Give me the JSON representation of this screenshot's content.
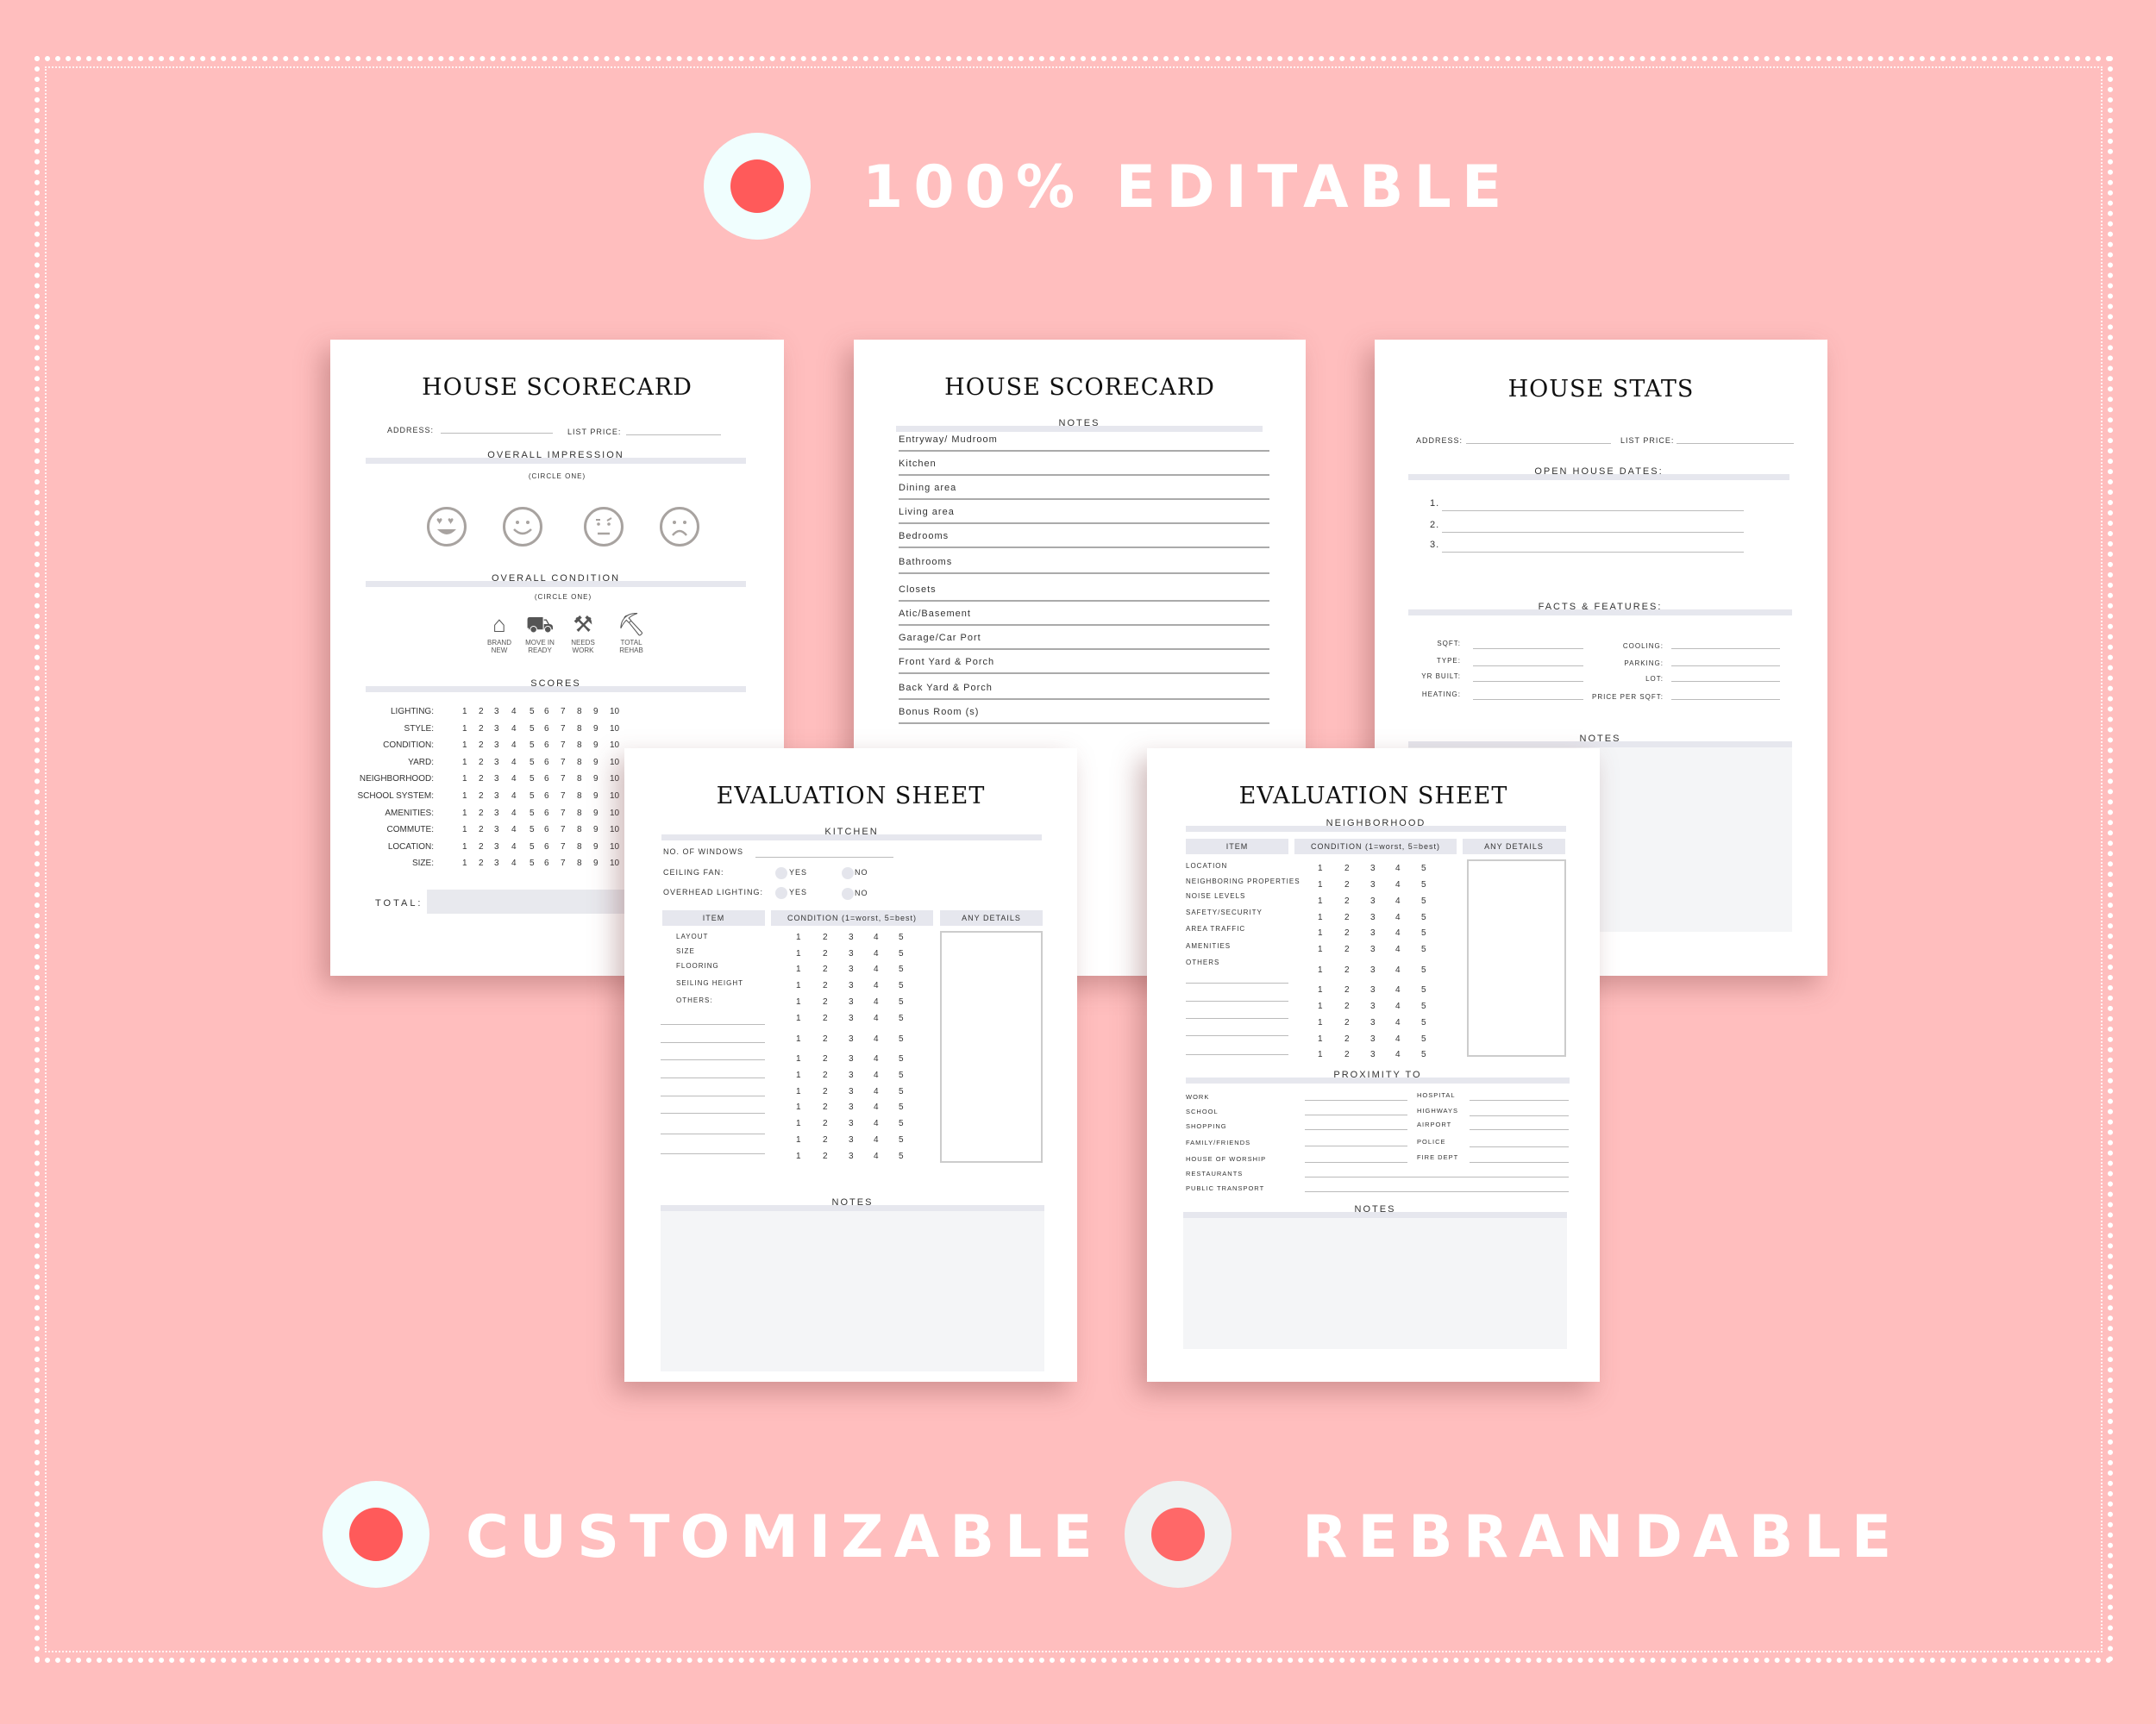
{
  "banner": {
    "top_label": "100% EDITABLE",
    "bottom_left_label": "CUSTOMIZABLE",
    "bottom_right_label": "REBRANDABLE",
    "colors": {
      "background": "#FFBEBE",
      "badge_outer": "#F0FEFE",
      "badge_inner": "#FF5A5A",
      "text": "#FFFFFF"
    }
  },
  "scorecard": {
    "title": "HOUSE SCORECARD",
    "address_label": "ADDRESS:",
    "list_price_label": "LIST PRICE:",
    "impression_header": "OVERALL IMPRESSION",
    "impression_sub": "(CIRCLE ONE)",
    "faces": [
      "heart-eyes-face-icon",
      "smile-face-icon",
      "unamused-face-icon",
      "frown-face-icon"
    ],
    "condition_header": "OVERALL CONDITION",
    "condition_sub": "(CIRCLE ONE)",
    "conditions": [
      {
        "icon": "house-icon",
        "glyph": "⌂",
        "line1": "BRAND",
        "line2": "NEW"
      },
      {
        "icon": "truck-icon",
        "glyph": "⛟",
        "line1": "MOVE IN",
        "line2": "READY"
      },
      {
        "icon": "spray-paint-icon",
        "glyph": "⚒",
        "line1": "NEEDS",
        "line2": "WORK"
      },
      {
        "icon": "wheelbarrow-icon",
        "glyph": "⛏",
        "line1": "TOTAL",
        "line2": "REHAB"
      }
    ],
    "scores_header": "SCORES",
    "score_items": [
      "LIGHTING:",
      "STYLE:",
      "CONDITION:",
      "YARD:",
      "NEIGHBORHOOD:",
      "SCHOOL SYSTEM:",
      "AMENITIES:",
      "COMMUTE:",
      "LOCATION:",
      "SIZE:"
    ],
    "score_scale": [
      "1",
      "2",
      "3",
      "4",
      "5",
      "6",
      "7",
      "8",
      "9",
      "10"
    ],
    "total_label": "TOTAL:"
  },
  "scorecard_notes": {
    "title": "HOUSE SCORECARD",
    "notes_header": "NOTES",
    "rooms": [
      "Entryway/ Mudroom",
      "Kitchen",
      "Dining area",
      "Living area",
      "Bedrooms",
      "Bathrooms",
      "Closets",
      "Atic/Basement",
      "Garage/Car Port",
      "Front Yard & Porch",
      "Back Yard & Porch",
      "Bonus Room (s)"
    ]
  },
  "stats": {
    "title": "HOUSE STATS",
    "address_label": "ADDRESS:",
    "list_price_label": "LIST PRICE:",
    "open_house_header": "OPEN HOUSE DATES:",
    "open_house_items": [
      "1.",
      "2.",
      "3."
    ],
    "facts_header": "FACTS & FEATURES:",
    "facts_left": [
      "SQFT:",
      "TYPE:",
      "YR BUILT:",
      "HEATING:"
    ],
    "facts_right": [
      "COOLING:",
      "PARKING:",
      "LOT:",
      "PRICE PER SQFT:"
    ],
    "notes_header": "NOTES"
  },
  "eval_kitchen": {
    "title": "EVALUATION SHEET",
    "section": "KITCHEN",
    "windows_label": "NO. OF WINDOWS",
    "ceiling_fan_label": "CEILING FAN:",
    "overhead_label": "OVERHEAD LIGHTING:",
    "yes": "YES",
    "no": "NO",
    "col_item": "ITEM",
    "col_condition": "CONDITION (1=worst, 5=best)",
    "col_details": "ANY DETAILS",
    "items": [
      "LAYOUT",
      "SIZE",
      "FLOORING",
      "SEILING HEIGHT",
      "OTHERS:"
    ],
    "scale": [
      "1",
      "2",
      "3",
      "4",
      "5"
    ],
    "notes_header": "NOTES"
  },
  "eval_neighborhood": {
    "title": "EVALUATION SHEET",
    "section": "NEIGHBORHOOD",
    "col_item": "ITEM",
    "col_condition": "CONDITION (1=worst, 5=best)",
    "col_details": "ANY DETAILS",
    "items": [
      "LOCATION",
      "NEIGHBORING PROPERTIES",
      "NOISE LEVELS",
      "SAFETY/SECURITY",
      "AREA TRAFFIC",
      "AMENITIES",
      "OTHERS"
    ],
    "scale": [
      "1",
      "2",
      "3",
      "4",
      "5"
    ],
    "proximity_header": "PROXIMITY TO",
    "proximity_left": [
      "WORK",
      "SCHOOL",
      "SHOPPING",
      "FAMILY/FRIENDS",
      "HOUSE OF WORSHIP",
      "RESTAURANTS",
      "PUBLIC TRANSPORT"
    ],
    "proximity_right": [
      "HOSPITAL",
      "HIGHWAYS",
      "AIRPORT",
      "POLICE",
      "FIRE DEPT"
    ],
    "notes_header": "NOTES"
  }
}
